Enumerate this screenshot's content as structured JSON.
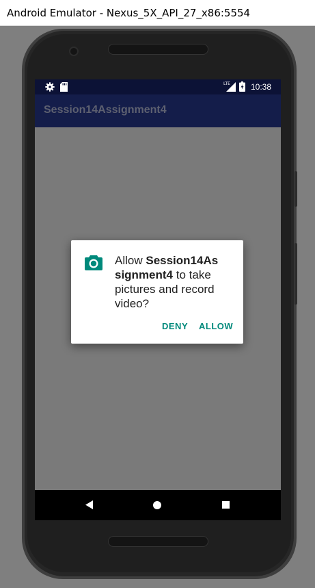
{
  "window": {
    "title": "Android Emulator - Nexus_5X_API_27_x86:5554"
  },
  "status_bar": {
    "time": "10:38",
    "network_label": "LTE",
    "icons": [
      "gear-icon",
      "sd-card-icon",
      "lte-signal-icon",
      "battery-icon"
    ]
  },
  "app_bar": {
    "title": "Session14Assignment4"
  },
  "permission_dialog": {
    "icon": "camera-icon",
    "message_prefix": "Allow ",
    "app_name_line1": "Session14As",
    "app_name_line2": "signment4",
    "message_suffix": " to take pictures and record video?",
    "deny_label": "DENY",
    "allow_label": "ALLOW",
    "accent_color": "#00897b"
  },
  "navigation_bar": {
    "icons": [
      "back-icon",
      "home-icon",
      "recents-icon"
    ]
  },
  "colors": {
    "status_bar": "#0c1236",
    "app_bar": "#141d4a",
    "scrim": "#7a7a7a"
  }
}
